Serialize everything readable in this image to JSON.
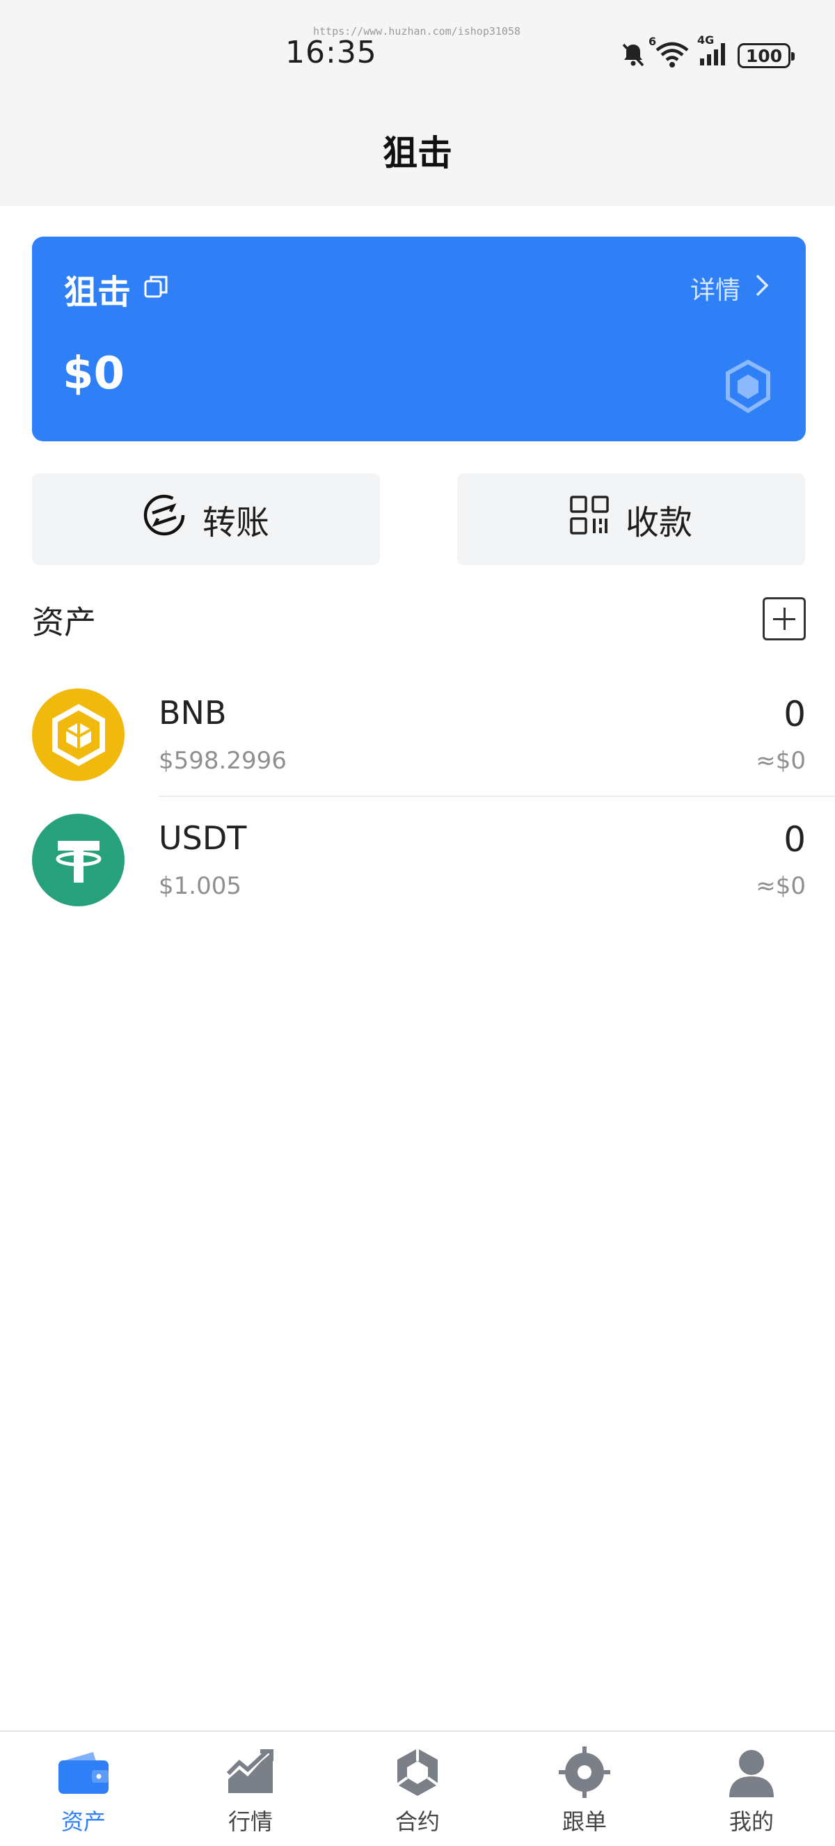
{
  "status_bar": {
    "watermark": "https://www.huzhan.com/ishop31058",
    "time": "16:35",
    "signal_label": "4G",
    "wifi_label": "6",
    "battery": "100"
  },
  "header": {
    "title": "狙击"
  },
  "wallet_card": {
    "name": "狙击",
    "detail_label": "详情",
    "balance": "$0",
    "icons": {
      "copy": "copy-icon",
      "chain": "bnb-chain-icon"
    }
  },
  "actions": {
    "transfer_label": "转账",
    "receive_label": "收款"
  },
  "assets": {
    "title": "资产",
    "items": [
      {
        "symbol": "BNB",
        "price": "$598.2996",
        "amount": "0",
        "value": "≈$0",
        "color": "#f0b90b"
      },
      {
        "symbol": "USDT",
        "price": "$1.005",
        "amount": "0",
        "value": "≈$0",
        "color": "#26a17b"
      }
    ]
  },
  "bottom_nav": {
    "items": [
      {
        "label": "资产",
        "icon": "wallet-icon",
        "active": true
      },
      {
        "label": "行情",
        "icon": "market-chart-icon"
      },
      {
        "label": "合约",
        "icon": "contract-icon"
      },
      {
        "label": "跟单",
        "icon": "target-icon"
      },
      {
        "label": "我的",
        "icon": "user-icon"
      }
    ]
  },
  "colors": {
    "accent": "#2f80f7",
    "bnb": "#f0b90b",
    "usdt": "#26a17b"
  }
}
